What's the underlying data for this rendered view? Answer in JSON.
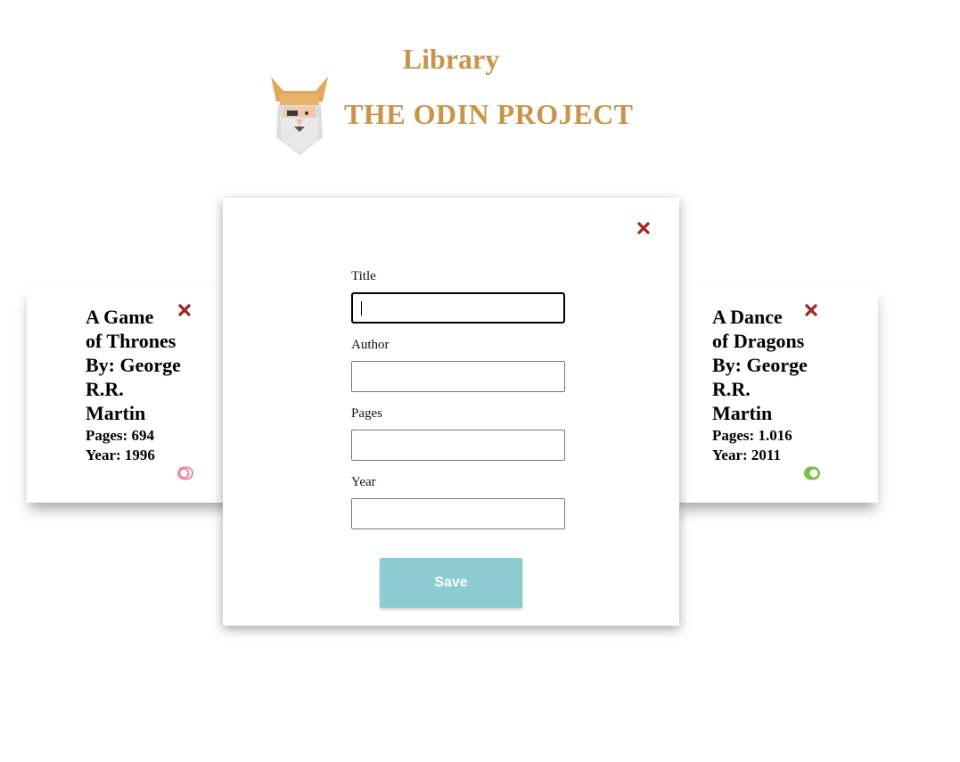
{
  "header": {
    "title": "Library",
    "brand": "THE ODIN PROJECT"
  },
  "books": [
    {
      "title_lines": [
        "A Game",
        "of Thrones",
        "By: George",
        "R.R.",
        "Martin"
      ],
      "pages": "Pages: 694",
      "year": "Year: 1996",
      "read": false
    },
    {
      "title_lines": [
        "A Dance",
        "of Dragons",
        "By: George",
        "R.R.",
        "Martin"
      ],
      "pages": "Pages: 1.016",
      "year": "Year: 2011",
      "read": true
    }
  ],
  "modal": {
    "title_label": "Title",
    "title_value": "",
    "author_label": "Author",
    "author_value": "",
    "pages_label": "Pages",
    "pages_value": "",
    "year_label": "Year",
    "year_value": "",
    "save_label": "Save"
  },
  "colors": {
    "brand": "#c9944b",
    "close": "#8b1a1a",
    "save": "#8ccbd0",
    "toggle_read": "#7ac142",
    "toggle_unread": "#f08aa3"
  },
  "icons": {
    "close": "close-icon",
    "toggle_on": "toggle-on-icon",
    "toggle_off": "toggle-off-icon",
    "logo": "odin-logo-icon"
  }
}
